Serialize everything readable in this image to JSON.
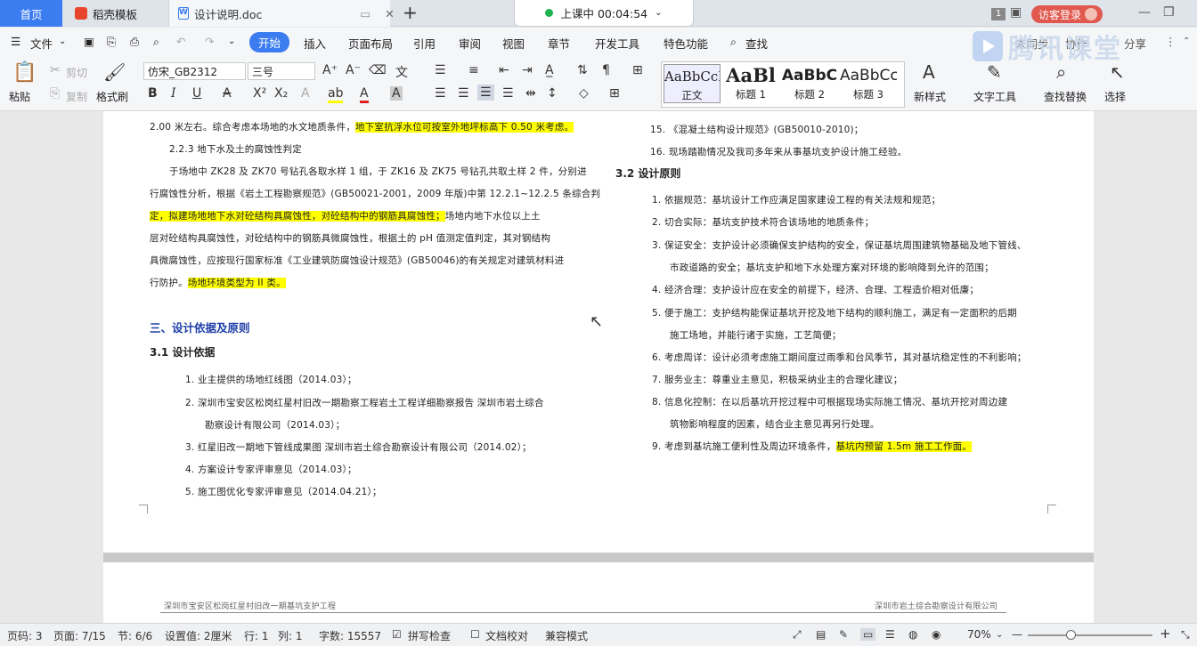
{
  "tabs": {
    "home": "首页",
    "template": "稻壳模板",
    "document": "设计说明.doc",
    "live_status": "上课中 00:04:54",
    "page_count": "1",
    "visitor": "访客登录"
  },
  "menu": [
    "文件",
    "开始",
    "插入",
    "页面布局",
    "引用",
    "审阅",
    "视图",
    "章节",
    "开发工具",
    "特色功能",
    "查找"
  ],
  "menu_right": [
    "未同步",
    "协作",
    "分享"
  ],
  "ribbon": {
    "paste": "粘贴",
    "cut": "剪切",
    "copy": "复制",
    "format_painter": "格式刷",
    "font_name": "仿宋_GB2312",
    "font_size": "三号",
    "styles": [
      {
        "preview": "AaBbCcDd",
        "name": "正文"
      },
      {
        "preview": "AaBl",
        "name": "标题 1"
      },
      {
        "preview": "AaBbC",
        "name": "标题 2"
      },
      {
        "preview": "AaBbCc",
        "name": "标题 3"
      }
    ],
    "new_style": "新样式",
    "text_tools": "文字工具",
    "find_replace": "查找替换",
    "select": "选择"
  },
  "watermark": "腾讯课堂",
  "doc_left": {
    "p1a": "2.00 米左右。综合考虑本场地的水文地质条件，",
    "p1b": "地下室抗浮水位可按室外地坪标高下 0.50 米考虑。",
    "s223": "2.2.3 地下水及土的腐蚀性判定",
    "p2": "于场地中 ZK28 及 ZK70 号钻孔各取水样 1 组，于 ZK16 及 ZK75 号钻孔共取土样 2 件，分别进",
    "p3": "行腐蚀性分析，根据《岩土工程勘察规范》(GB50021-2001，2009 年版)中第 12.2.1~12.2.5 条综合判",
    "p4a": "定，",
    "p4b": "拟建场地地下水对砼结构具腐蚀性，对砼结构中的钢筋具腐蚀性；",
    "p4c": "场地内地下水位以上土",
    "p5": "层对砼结构具腐蚀性，对砼结构中的钢筋具微腐蚀性，根据土的 pH 值测定值判定，其对钢结构",
    "p6": "具微腐蚀性，应按现行国家标准《工业建筑防腐蚀设计规范》(GB50046)的有关规定对建筑材料进",
    "p7a": "行防护。",
    "p7b": "场地环境类型为 II 类。",
    "h_section": "三、设计依据及原则",
    "h_31": "3.1  设计依据",
    "items": [
      "1.   业主提供的场地红线图（2014.03）；",
      "2.   深圳市宝安区松岗红星村旧改一期勘察工程岩土工程详细勘察报告    深圳市岩土综合",
      "勘察设计有限公司（2014.03）；",
      "3.   红星旧改一期地下管线成果图   深圳市岩土综合勘察设计有限公司（2014.02）；",
      "4.   方案设计专家评审意见（2014.03）；",
      "5.   施工图优化专家评审意见（2014.04.21）；"
    ]
  },
  "doc_right": {
    "r15": "15.   《混凝土结构设计规范》(GB50010-2010)；",
    "r16": "16.   现场踏勘情况及我司多年来从事基坑支护设计施工经验。",
    "h_32": "3.2  设计原则",
    "items": [
      "1.   依据规范：基坑设计工作应满足国家建设工程的有关法规和规范；",
      "2.   切合实际：基坑支护技术符合该场地的地质条件；",
      "3.   保证安全：支护设计必须确保支护结构的安全，保证基坑周围建筑物基础及地下管线、",
      "市政道路的安全；基坑支护和地下水处理方案对环境的影响降到允许的范围；",
      "4.   经济合理：支护设计应在安全的前提下，经济、合理、工程造价相对低廉；",
      "5.   便于施工：支护结构能保证基坑开挖及地下结构的顺利施工，满足有一定面积的后期",
      "施工场地，并能行诸于实施，工艺简便；",
      "6.   考虑周详：设计必须考虑施工期间度过雨季和台风季节，其对基坑稳定性的不利影响；",
      "7.   服务业主：尊重业主意见，积极采纳业主的合理化建议；",
      "8.   信息化控制：在以后基坑开挖过程中可根据现场实际施工情况、基坑开挖对周边建",
      "筑物影响程度的因素，结合业主意见再另行处理。"
    ],
    "r9a": "9.   考虑到基坑施工便利性及周边环境条件，",
    "r9b": "基坑内预留 1.5m 施工工作面。"
  },
  "page2": {
    "header_left": "深圳市宝安区松岗红星村旧改一期基坑支护工程",
    "header_right": "深圳市岩土综合勘察设计有限公司"
  },
  "status": {
    "page": "页码: 3",
    "pages": "页面: 7/15",
    "section": "节: 6/6",
    "setting": "设置值: 2厘米",
    "row": "行: 1",
    "col": "列: 1",
    "words": "字数: 15557",
    "spell": "拼写检查",
    "proof": "文档校对",
    "compat": "兼容模式",
    "zoom": "70%"
  }
}
